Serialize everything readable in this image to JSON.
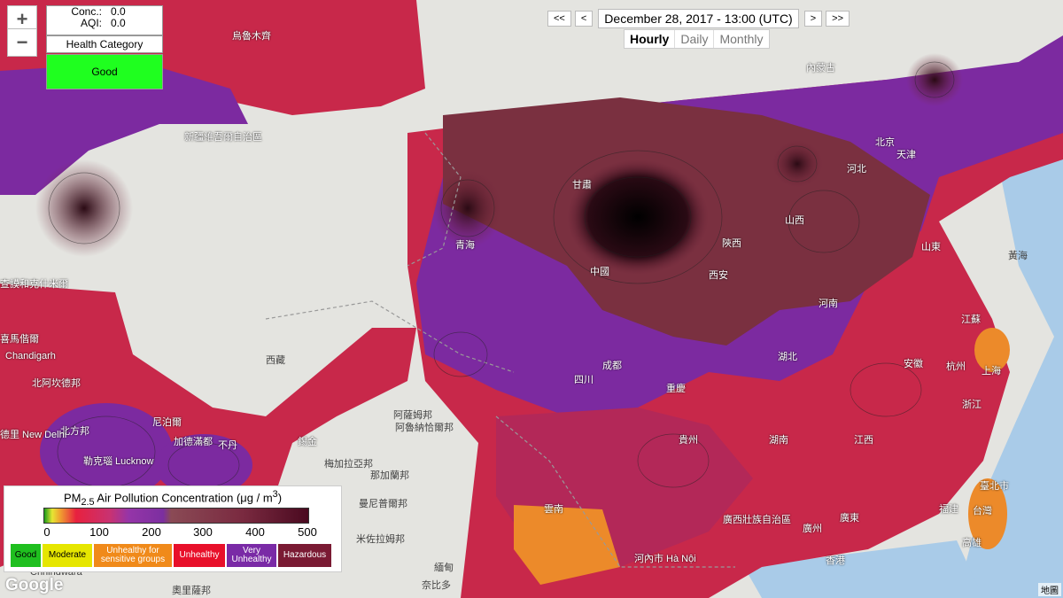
{
  "readout": {
    "conc_label": "Conc.:",
    "conc_value": "0.0",
    "aqi_label": "AQI:",
    "aqi_value": "0.0"
  },
  "health": {
    "label": "Health Category",
    "value": "Good",
    "color": "#1fff1f"
  },
  "zoom": {
    "in": "+",
    "out": "−"
  },
  "nav": {
    "first": "<<",
    "prev": "<",
    "date": "December 28, 2017 - 13:00 (UTC)",
    "next": ">",
    "last": ">>"
  },
  "tabs": [
    "Hourly",
    "Daily",
    "Monthly"
  ],
  "legend": {
    "title_pre": "PM",
    "title_sub": "2.5",
    "title_post": " Air Pollution Concentration (μg / m",
    "title_sup": "3",
    "title_end": ")",
    "ticks": [
      "0",
      "100",
      "200",
      "300",
      "400",
      "500"
    ],
    "categories": [
      {
        "label": "Good",
        "color": "#1fbf1f",
        "text": "#000"
      },
      {
        "label": "Moderate",
        "color": "#e6e600",
        "text": "#000"
      },
      {
        "label": "Unhealthy for sensitive groups",
        "color": "#f08a1a",
        "text": "#fff"
      },
      {
        "label": "Unhealthy",
        "color": "#e8102a",
        "text": "#fff"
      },
      {
        "label": "Very Unhealthy",
        "color": "#7a2aa6",
        "text": "#fff"
      },
      {
        "label": "Hazardous",
        "color": "#7a1a33",
        "text": "#fff"
      }
    ]
  },
  "places": [
    {
      "name": "烏魯木齊",
      "cls": ""
    },
    {
      "name": "新疆維吾爾自治區",
      "cls": ""
    },
    {
      "name": "西藏",
      "cls": "dark"
    },
    {
      "name": "青海",
      "cls": ""
    },
    {
      "name": "甘肅",
      "cls": ""
    },
    {
      "name": "中國",
      "cls": ""
    },
    {
      "name": "西安",
      "cls": ""
    },
    {
      "name": "陝西",
      "cls": ""
    },
    {
      "name": "山西",
      "cls": ""
    },
    {
      "name": "河南",
      "cls": ""
    },
    {
      "name": "河北",
      "cls": ""
    },
    {
      "name": "北京",
      "cls": ""
    },
    {
      "name": "天津",
      "cls": ""
    },
    {
      "name": "內蒙古",
      "cls": ""
    },
    {
      "name": "山東",
      "cls": ""
    },
    {
      "name": "江蘇",
      "cls": ""
    },
    {
      "name": "上海",
      "cls": ""
    },
    {
      "name": "杭州",
      "cls": ""
    },
    {
      "name": "安徽",
      "cls": ""
    },
    {
      "name": "湖北",
      "cls": ""
    },
    {
      "name": "成都",
      "cls": ""
    },
    {
      "name": "四川",
      "cls": ""
    },
    {
      "name": "重慶",
      "cls": ""
    },
    {
      "name": "湖南",
      "cls": ""
    },
    {
      "name": "江西",
      "cls": ""
    },
    {
      "name": "浙江",
      "cls": ""
    },
    {
      "name": "福建",
      "cls": ""
    },
    {
      "name": "貴州",
      "cls": ""
    },
    {
      "name": "雲南",
      "cls": ""
    },
    {
      "name": "廣西壯族自治區",
      "cls": ""
    },
    {
      "name": "廣州",
      "cls": ""
    },
    {
      "name": "廣東",
      "cls": ""
    },
    {
      "name": "香港",
      "cls": ""
    },
    {
      "name": "臺北市",
      "cls": ""
    },
    {
      "name": "台灣",
      "cls": ""
    },
    {
      "name": "高雄",
      "cls": ""
    },
    {
      "name": "河內市 Hà Nội",
      "cls": ""
    },
    {
      "name": "緬甸",
      "cls": "dark"
    },
    {
      "name": "奈比多",
      "cls": "dark"
    },
    {
      "name": "尼泊爾",
      "cls": ""
    },
    {
      "name": "加德滿都",
      "cls": ""
    },
    {
      "name": "不丹",
      "cls": ""
    },
    {
      "name": "錫金",
      "cls": ""
    },
    {
      "name": "阿薩姆邦",
      "cls": "dark"
    },
    {
      "name": "阿魯納恰爾邦",
      "cls": "dark"
    },
    {
      "name": "北方邦",
      "cls": ""
    },
    {
      "name": "勒克瑙 Lucknow",
      "cls": ""
    },
    {
      "name": "德里 New Delhi",
      "cls": ""
    },
    {
      "name": "北阿坎德邦",
      "cls": ""
    },
    {
      "name": "Chandigarh",
      "cls": ""
    },
    {
      "name": "喜馬偕爾",
      "cls": ""
    },
    {
      "name": "查謨和克什米爾",
      "cls": ""
    },
    {
      "name": "梅加拉亞邦",
      "cls": "dark"
    },
    {
      "name": "那加蘭邦",
      "cls": "dark"
    },
    {
      "name": "曼尼普爾邦",
      "cls": "dark"
    },
    {
      "name": "米佐拉姆邦",
      "cls": "dark"
    },
    {
      "name": "奧里薩邦",
      "cls": "dark"
    },
    {
      "name": "黃海",
      "cls": "dark"
    },
    {
      "name": "Chhindwara",
      "cls": "dark"
    }
  ],
  "attribution": "地圖"
}
